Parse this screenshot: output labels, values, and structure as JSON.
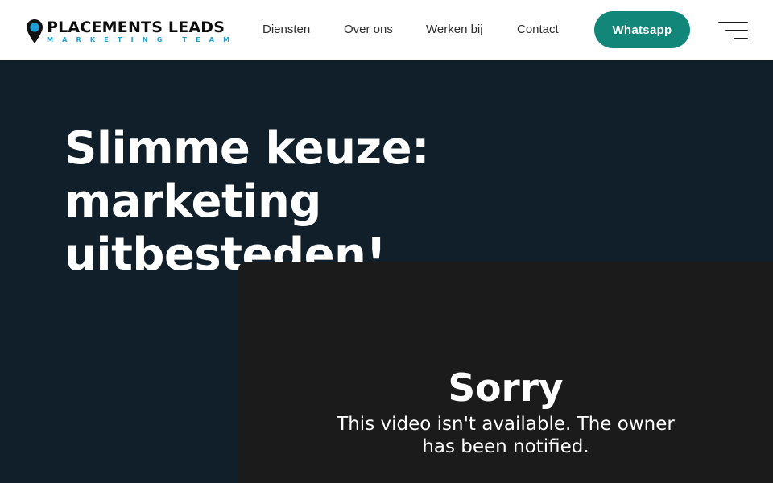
{
  "header": {
    "logo": {
      "main": "PLACEMENTS LEADS",
      "sub": "MARKETING TEAM",
      "icon": "map-pin-icon"
    },
    "nav": [
      {
        "label": "Diensten"
      },
      {
        "label": "Over ons"
      },
      {
        "label": "Werken bij"
      },
      {
        "label": "Contact"
      }
    ],
    "cta_label": "Whatsapp",
    "menu_icon": "hamburger-menu-icon"
  },
  "hero": {
    "title_line1": "Slimme keuze: marketing",
    "title_line2": "uitbesteden!"
  },
  "video": {
    "heading": "Sorry",
    "message": "This video isn't available. The owner has been notified."
  },
  "colors": {
    "header_bg": "#ffffff",
    "page_bg": "#111f2a",
    "accent": "#13867a",
    "logo_blue": "#1aa0d8",
    "video_bg": "#1b1b1b"
  }
}
